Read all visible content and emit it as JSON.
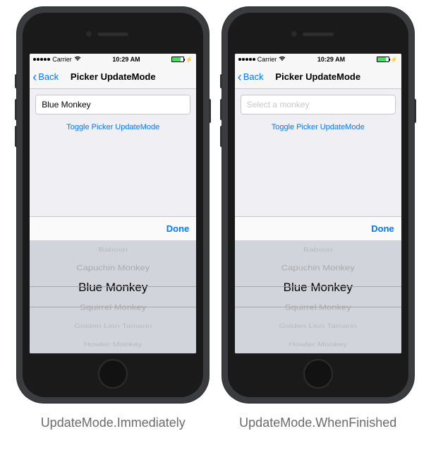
{
  "status": {
    "carrier": "Carrier",
    "time": "10:29 AM"
  },
  "nav": {
    "back_label": "Back",
    "title": "Picker UpdateMode"
  },
  "left": {
    "input_value": "Blue Monkey",
    "toggle_label": "Toggle Picker UpdateMode",
    "done_label": "Done",
    "caption": "UpdateMode.Immediately"
  },
  "right": {
    "input_placeholder": "Select a monkey",
    "toggle_label": "Toggle Picker UpdateMode",
    "done_label": "Done",
    "caption": "UpdateMode.WhenFinished"
  },
  "picker": {
    "items": {
      "0": "Baboon",
      "1": "Capuchin Monkey",
      "2": "Blue Monkey",
      "3": "Squirrel Monkey",
      "4": "Golden Lion Tamarin",
      "5": "Howler Monkey"
    }
  }
}
